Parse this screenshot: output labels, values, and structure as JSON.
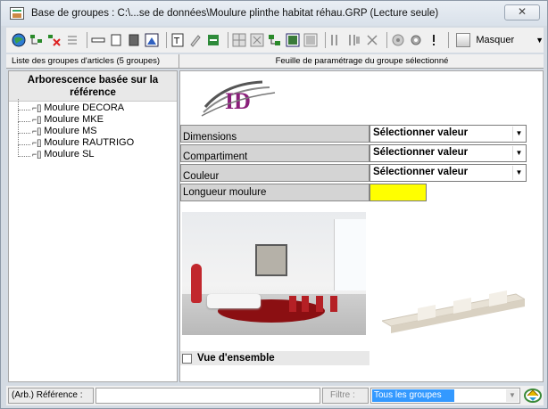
{
  "window": {
    "title": "Base de groupes : C:\\...se de données\\Moulure plinthe habitat réhau.GRP (Lecture seule)",
    "close_label": "✕"
  },
  "toolbar": {
    "icons": [
      "globe-icon",
      "tree-icon",
      "tree-delete-icon",
      "list-icon",
      "sep",
      "line-icon",
      "rect-icon",
      "dark-rect-icon",
      "chart-icon",
      "sep",
      "text-icon",
      "edit-icon",
      "green-icon",
      "sep",
      "grid-icon",
      "grid2-icon",
      "tree-green-icon",
      "image-icon",
      "photo-icon",
      "sep",
      "new-icon",
      "new2-icon",
      "delete-icon",
      "sep",
      "circle-icon",
      "gear-icon",
      "exclaim-icon",
      "sep",
      "hide-icon"
    ],
    "masquer_label": "Masquer"
  },
  "panels": {
    "left_header": "Liste des groupes d'articles (5 groupes)",
    "right_header": "Feuille de paramétrage du groupe sélectionné"
  },
  "tree": {
    "title": "Arborescence basée sur la référence",
    "items": [
      {
        "label": "Moulure DECORA"
      },
      {
        "label": "Moulure MKE"
      },
      {
        "label": "Moulure MS"
      },
      {
        "label": "Moulure RAUTRIGO"
      },
      {
        "label": "Moulure SL"
      }
    ]
  },
  "params": {
    "rows": [
      {
        "label": "Dimensions",
        "value": "Sélectionner valeur"
      },
      {
        "label": "Compartiment",
        "value": "Sélectionner valeur"
      },
      {
        "label": "Couleur",
        "value": "Sélectionner valeur"
      }
    ],
    "length_label": "Longueur moulure",
    "length_color": "#ffff00"
  },
  "overview": {
    "label": "Vue d'ensemble",
    "checked": false
  },
  "bottom": {
    "ref_label": "(Arb.) Référence :",
    "ref_value": "",
    "filter_label": "Filtre :",
    "filter_value": "Tous les groupes"
  },
  "colors": {
    "accent": "#3399ff",
    "rug": "#8b0f12",
    "chair": "#b52025"
  }
}
